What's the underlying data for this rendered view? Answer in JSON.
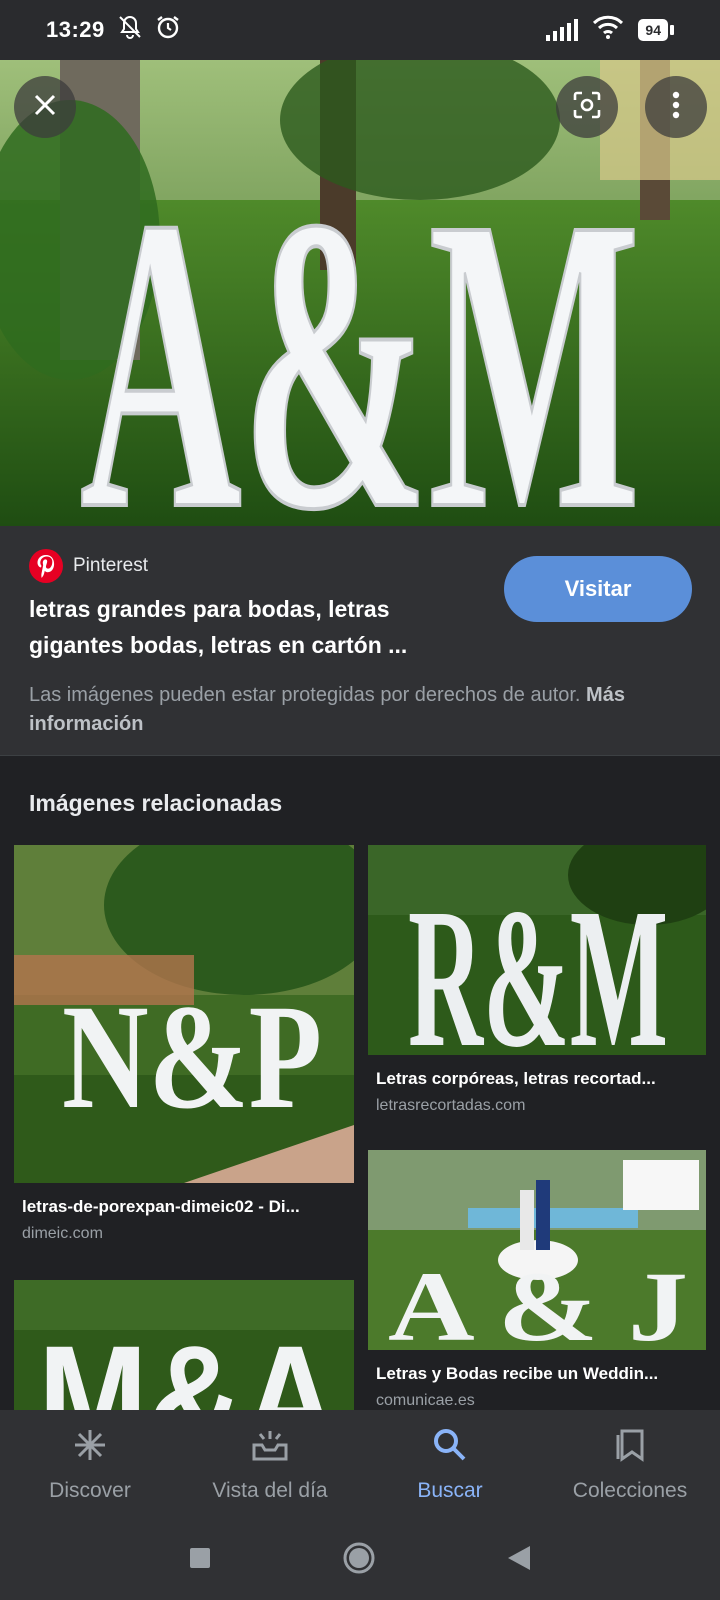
{
  "status_bar": {
    "time": "13:29",
    "battery": "94",
    "left_icons": [
      "mute-icon",
      "alarm-icon"
    ],
    "right_icons": [
      "signal-icon",
      "wifi-icon",
      "battery-icon"
    ]
  },
  "hero": {
    "alt_letters": "A&M",
    "close_icon": "close-icon",
    "lens_icon": "lens-icon",
    "more_icon": "more-vert-icon"
  },
  "result": {
    "source": "Pinterest",
    "title": "letras grandes para bodas, letras gigantes bodas, letras en cartón ...",
    "visit_label": "Visitar",
    "rights_text": "Las imágenes pueden estar protegidas por derechos de autor.",
    "more_info": "Más información"
  },
  "related": {
    "heading": "Imágenes relacionadas",
    "items": [
      {
        "letters": "N&P",
        "title": "letras-de-porexpan-dimeic02 - Di...",
        "domain": "dimeic.com"
      },
      {
        "letters": "R&M",
        "title": "Letras corpóreas, letras recortad...",
        "domain": "letrasrecortadas.com"
      },
      {
        "letters": "A & J",
        "title": "Letras y Bodas recibe un Weddin...",
        "domain": "comunicae.es"
      },
      {
        "letters": "M&A"
      }
    ]
  },
  "bottom_nav": {
    "items": [
      {
        "label": "Discover",
        "icon": "discover-icon"
      },
      {
        "label": "Vista del día",
        "icon": "today-icon"
      },
      {
        "label": "Buscar",
        "icon": "search-icon",
        "active": true
      },
      {
        "label": "Colecciones",
        "icon": "collections-icon"
      }
    ]
  },
  "colors": {
    "background": "#202124",
    "panel": "#303134",
    "accent": "#8ab4f8",
    "visit_button": "#5b8fd9",
    "pinterest": "#e60023"
  }
}
